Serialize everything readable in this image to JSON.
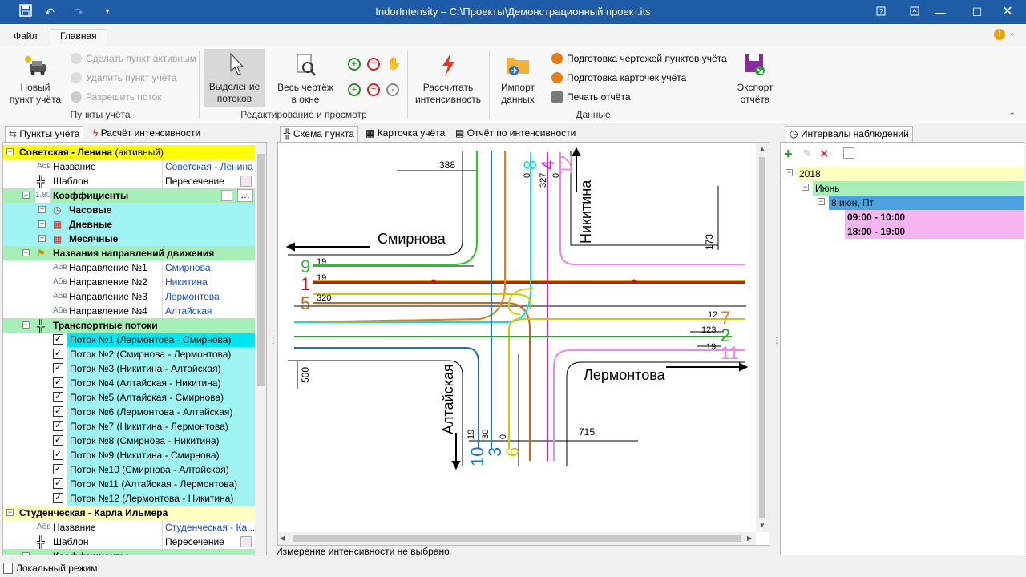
{
  "window": {
    "title": "IndorIntensity – C:\\Проекты\\Демонстрационный проект.its"
  },
  "ribbon_tabs": [
    "Файл",
    "Главная"
  ],
  "ribbon": {
    "new_point": "Новый\nпункт учёта",
    "make_active": "Сделать пункт активным",
    "delete_point": "Удалить пункт учёта",
    "allow_flow": "Разрешить поток",
    "group_points": "Пункты учёта",
    "select_flows": "Выделение\nпотоков",
    "whole_drawing": "Весь чертёж\nв окне",
    "group_edit": "Редактирование и просмотр",
    "calc": "Рассчитать\nинтенсивность",
    "import": "Импорт\nданных",
    "prep_drawings": "Подготовка чертежей пунктов учёта",
    "prep_cards": "Подготовка карточек учёта",
    "print_report": "Печать отчёта",
    "group_data": "Данные",
    "export": "Экспорт\nотчёта"
  },
  "left_tabs": [
    "Пункты учёта",
    "Расчёт интенсивности"
  ],
  "tree": {
    "point1": {
      "name": "Советская - Ленина",
      "status": "(активный)"
    },
    "name_label": "Название",
    "name_value": "Советская - Ленина",
    "template_label": "Шаблон",
    "template_value": "Пересечение",
    "coef": "Коэффициенты",
    "hourly": "Часовые",
    "daily": "Дневные",
    "monthly": "Месячные",
    "dir_names": "Названия направлений движения",
    "directions": [
      {
        "k": "Направление №1",
        "v": "Смирнова"
      },
      {
        "k": "Направление №2",
        "v": "Никитина"
      },
      {
        "k": "Направление №3",
        "v": "Лермонтова"
      },
      {
        "k": "Направление №4",
        "v": "Алтайская"
      }
    ],
    "flows_header": "Транспортные потоки",
    "flows": [
      "Поток №1 (Лермонтова - Смирнова)",
      "Поток №2 (Смирнова - Лермонтова)",
      "Поток №3 (Никитина - Алтайская)",
      "Поток №4 (Алтайская - Никитина)",
      "Поток №5 (Алтайская - Смирнова)",
      "Поток №6 (Лермонтова - Алтайская)",
      "Поток №7 (Никитина - Лермонтова)",
      "Поток №8 (Смирнова - Никитина)",
      "Поток №9 (Никитина - Смирнова)",
      "Поток №10 (Смирнова - Алтайская)",
      "Поток №11 (Алтайская - Лермонтова)",
      "Поток №12 (Лермонтова - Никитина)"
    ],
    "point2": {
      "name": "Студенческая - Карла Ильмера"
    },
    "name_value2": "Студенческая - Ка...",
    "template_value2": "Пересечение",
    "abv": "Абв",
    "coef_num": "1,80"
  },
  "center_tabs": [
    "Схема пункта",
    "Карточка учёта",
    "Отчёт по интенсивности"
  ],
  "diagram": {
    "streets": {
      "smirnova": "Смирнова",
      "nikitina": "Никитина",
      "lermontova": "Лермонтова",
      "altayskaya": "Алтайская"
    },
    "numbers": {
      "n388": "388",
      "n173": "173",
      "n500": "500",
      "n715": "715",
      "n0a": "0",
      "n327": "327",
      "n0b": "0",
      "n19a": "19",
      "n19b": "19",
      "n320": "320",
      "n12": "12",
      "n123": "123",
      "n19c": "19",
      "n19d": "19",
      "n30": "30",
      "n0c": "0"
    },
    "flow_labels": {
      "f9": "9",
      "f1": "1",
      "f5": "5",
      "f8": "8",
      "f4": "4",
      "f12": "12",
      "f7": "7",
      "f2": "2",
      "f11": "11",
      "f10": "10",
      "f3": "3",
      "f6": "6"
    }
  },
  "center_status": "Измерение интенсивности не выбрано",
  "right": {
    "tab": "Интервалы наблюдений",
    "year": "2018",
    "month": "Июнь",
    "day": "8 июн, Пт",
    "intervals": [
      "09:00 - 10:00",
      "18:00 - 19:00"
    ]
  },
  "status": "Локальный режим"
}
